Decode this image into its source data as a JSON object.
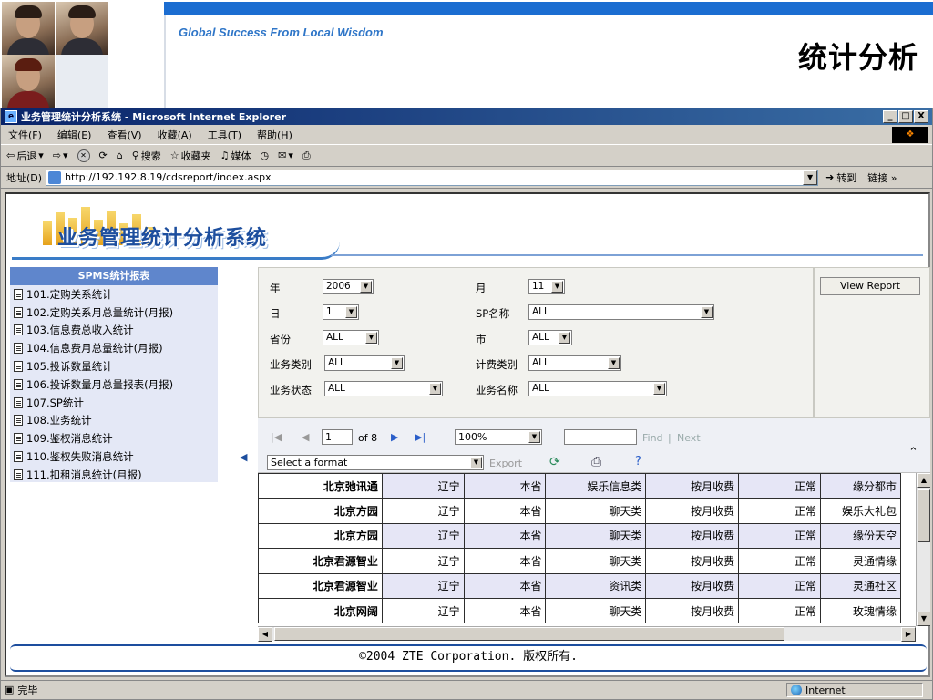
{
  "slide": {
    "slogan": "Global Success From Local Wisdom",
    "title": "统计分析"
  },
  "window": {
    "title": "业务管理统计分析系统 - Microsoft Internet Explorer",
    "min": "_",
    "max": "□",
    "close": "X"
  },
  "menu": [
    "文件(F)",
    "编辑(E)",
    "查看(V)",
    "收藏(A)",
    "工具(T)",
    "帮助(H)"
  ],
  "toolbar": {
    "back": "后退",
    "search": "搜索",
    "favorites": "收藏夹",
    "media": "媒体"
  },
  "address": {
    "label": "地址(D)",
    "url": "http://192.192.8.19/cdsreport/index.aspx",
    "go": "转到",
    "links": "链接 »"
  },
  "app": {
    "title": "业务管理统计分析系统"
  },
  "sidebar": {
    "header": "SPMS统计报表",
    "items": [
      "101.定购关系统计",
      "102.定购关系月总量统计(月报)",
      "103.信息费总收入统计",
      "104.信息费月总量统计(月报)",
      "105.投诉数量统计",
      "106.投诉数量月总量报表(月报)",
      "107.SP统计",
      "108.业务统计",
      "109.鉴权消息统计",
      "110.鉴权失败消息统计",
      "111.扣租消息统计(月报)"
    ]
  },
  "filters": {
    "year": {
      "label": "年",
      "value": "2006"
    },
    "month": {
      "label": "月",
      "value": "11"
    },
    "day": {
      "label": "日",
      "value": "1"
    },
    "sp_name": {
      "label": "SP名称",
      "value": "ALL"
    },
    "province": {
      "label": "省份",
      "value": "ALL"
    },
    "city": {
      "label": "市",
      "value": "ALL"
    },
    "service_type": {
      "label": "业务类别",
      "value": "ALL"
    },
    "billing_type": {
      "label": "计费类别",
      "value": "ALL"
    },
    "service_status": {
      "label": "业务状态",
      "value": "ALL"
    },
    "service_name": {
      "label": "业务名称",
      "value": "ALL"
    }
  },
  "report": {
    "view_report": "View Report"
  },
  "viewer": {
    "page": "1",
    "of_pages": "of 8",
    "zoom": "100%",
    "find": "Find",
    "separator": "|",
    "next": "Next",
    "format_placeholder": "Select a format",
    "export": "Export"
  },
  "grid": {
    "rows": [
      [
        "北京弛讯通",
        "辽宁",
        "本省",
        "娱乐信息类",
        "按月收费",
        "正常",
        "缘分都市"
      ],
      [
        "北京方园",
        "辽宁",
        "本省",
        "聊天类",
        "按月收费",
        "正常",
        "娱乐大礼包"
      ],
      [
        "北京方园",
        "辽宁",
        "本省",
        "聊天类",
        "按月收费",
        "正常",
        "缘份天空"
      ],
      [
        "北京君源智业",
        "辽宁",
        "本省",
        "聊天类",
        "按月收费",
        "正常",
        "灵通情缘"
      ],
      [
        "北京君源智业",
        "辽宁",
        "本省",
        "资讯类",
        "按月收费",
        "正常",
        "灵通社区"
      ],
      [
        "北京网阔",
        "辽宁",
        "本省",
        "聊天类",
        "按月收费",
        "正常",
        "玫瑰情缘"
      ]
    ]
  },
  "footer": "©2004 ZTE Corporation. 版权所有.",
  "status": {
    "text": "完毕",
    "zone": "Internet"
  },
  "colors": {
    "accent_blue": "#1b6dd1",
    "sidebar_header": "#5f86cc",
    "sidebar_bg": "#e4e8f6",
    "grid_alt": "#e6e6f6"
  }
}
